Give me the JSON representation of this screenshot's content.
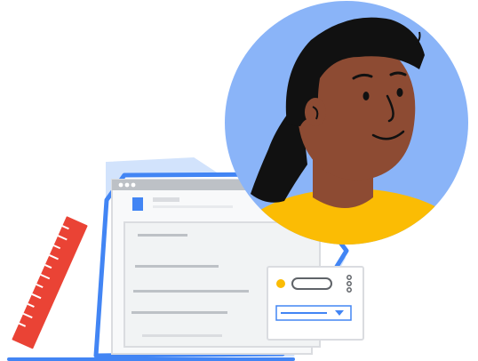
{
  "illustration": {
    "palette": {
      "circle_bg": "#8AB4F8",
      "blue": "#4285F4",
      "light_blue": "#D2E3FC",
      "frame_gray": "#DADCE0",
      "panel_gray": "#F1F3F4",
      "line_gray": "#DADCE0",
      "dark_gray": "#5F6368",
      "red": "#EA4335",
      "yellow": "#FBBC04",
      "skin": "#8D4B33",
      "hair": "#111111",
      "white": "#FFFFFF"
    }
  }
}
